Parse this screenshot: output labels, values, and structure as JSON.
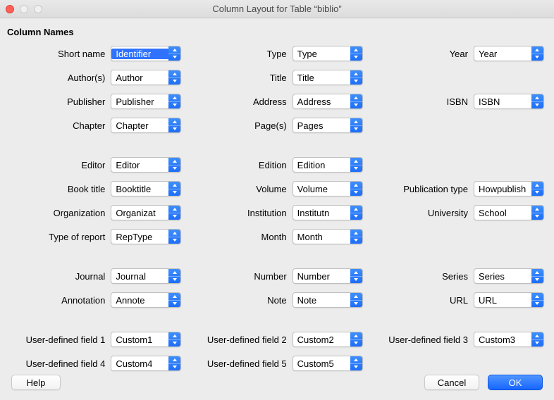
{
  "window": {
    "title": "Column Layout for Table “biblio”"
  },
  "heading": "Column Names",
  "columns": {
    "short_name": {
      "label": "Short name",
      "value": "Identifier"
    },
    "type": {
      "label": "Type",
      "value": "Type"
    },
    "year": {
      "label": "Year",
      "value": "Year"
    },
    "authors": {
      "label": "Author(s)",
      "value": "Author"
    },
    "title": {
      "label": "Title",
      "value": "Title"
    },
    "publisher": {
      "label": "Publisher",
      "value": "Publisher"
    },
    "address": {
      "label": "Address",
      "value": "Address"
    },
    "isbn": {
      "label": "ISBN",
      "value": "ISBN"
    },
    "chapter": {
      "label": "Chapter",
      "value": "Chapter"
    },
    "pages": {
      "label": "Page(s)",
      "value": "Pages"
    },
    "editor": {
      "label": "Editor",
      "value": "Editor"
    },
    "edition": {
      "label": "Edition",
      "value": "Edition"
    },
    "book_title": {
      "label": "Book title",
      "value": "Booktitle"
    },
    "volume": {
      "label": "Volume",
      "value": "Volume"
    },
    "publication_type": {
      "label": "Publication type",
      "value": "Howpublish"
    },
    "organization": {
      "label": "Organization",
      "value": "Organizat"
    },
    "institution": {
      "label": "Institution",
      "value": "Institutn"
    },
    "university": {
      "label": "University",
      "value": "School"
    },
    "type_of_report": {
      "label": "Type of report",
      "value": "RepType"
    },
    "month": {
      "label": "Month",
      "value": "Month"
    },
    "journal": {
      "label": "Journal",
      "value": "Journal"
    },
    "number": {
      "label": "Number",
      "value": "Number"
    },
    "series": {
      "label": "Series",
      "value": "Series"
    },
    "annotation": {
      "label": "Annotation",
      "value": "Annote"
    },
    "note": {
      "label": "Note",
      "value": "Note"
    },
    "url": {
      "label": "URL",
      "value": "URL"
    },
    "user1": {
      "label": "User-defined field 1",
      "value": "Custom1"
    },
    "user2": {
      "label": "User-defined field 2",
      "value": "Custom2"
    },
    "user3": {
      "label": "User-defined field 3",
      "value": "Custom3"
    },
    "user4": {
      "label": "User-defined field 4",
      "value": "Custom4"
    },
    "user5": {
      "label": "User-defined field 5",
      "value": "Custom5"
    }
  },
  "buttons": {
    "help": "Help",
    "cancel": "Cancel",
    "ok": "OK"
  }
}
